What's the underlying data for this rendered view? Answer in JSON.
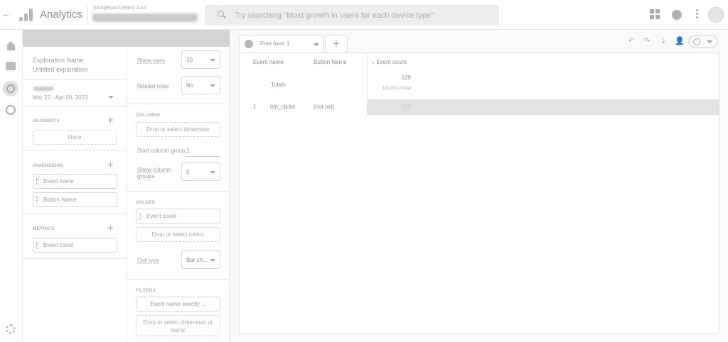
{
  "topbar": {
    "app_title": "Analytics",
    "account_line": "StringBoard (Main) GA4",
    "property_name": "StringBoard (Main) GA4",
    "search_placeholder": "Try searching \"Most growth in users for each device type\""
  },
  "variables": {
    "exploration_name_label": "Exploration Name:",
    "exploration_name_value": "Untitled exploration",
    "date_range": "Mar 22 - Apr 20, 2023",
    "segments_heading": "SEGMENTS",
    "segments_empty": "None",
    "dimensions_heading": "DIMENSIONS",
    "dimensions": [
      "Event name",
      "Button Name"
    ],
    "metrics_heading": "METRICS",
    "metrics": [
      "Event count"
    ]
  },
  "tab_settings": {
    "show_rows_label": "Show rows",
    "show_rows_value": "10",
    "nested_rows_label": "Nested rows",
    "nested_rows_value": "No",
    "columns_heading": "COLUMNS",
    "columns_drop": "Drop or select dimension",
    "start_column_group_label": "Start column group",
    "start_column_group_value": "1",
    "show_column_groups_label": "Show column groups",
    "show_column_groups_value": "5",
    "values_heading": "VALUES",
    "values_chip": "Event count",
    "values_drop": "Drop or select metric",
    "cell_type_label": "Cell type",
    "cell_type_value": "Bar ch...",
    "filters_heading": "FILTERS",
    "filter_chip": "Event name exactly ...",
    "filters_drop": "Drop or select dimension or metric"
  },
  "canvas": {
    "tab_label": "Free form 1",
    "add_tab": "+",
    "table": {
      "headers": [
        "Event name",
        "Button Name",
        "↓ Event count"
      ],
      "totals_label": "Totals",
      "totals_value": "129",
      "totals_percent": "100.0% of total",
      "rows": [
        {
          "index": "1",
          "event_name": "btn_clicks",
          "button_name": "(not set)",
          "event_count": "129"
        }
      ]
    }
  }
}
